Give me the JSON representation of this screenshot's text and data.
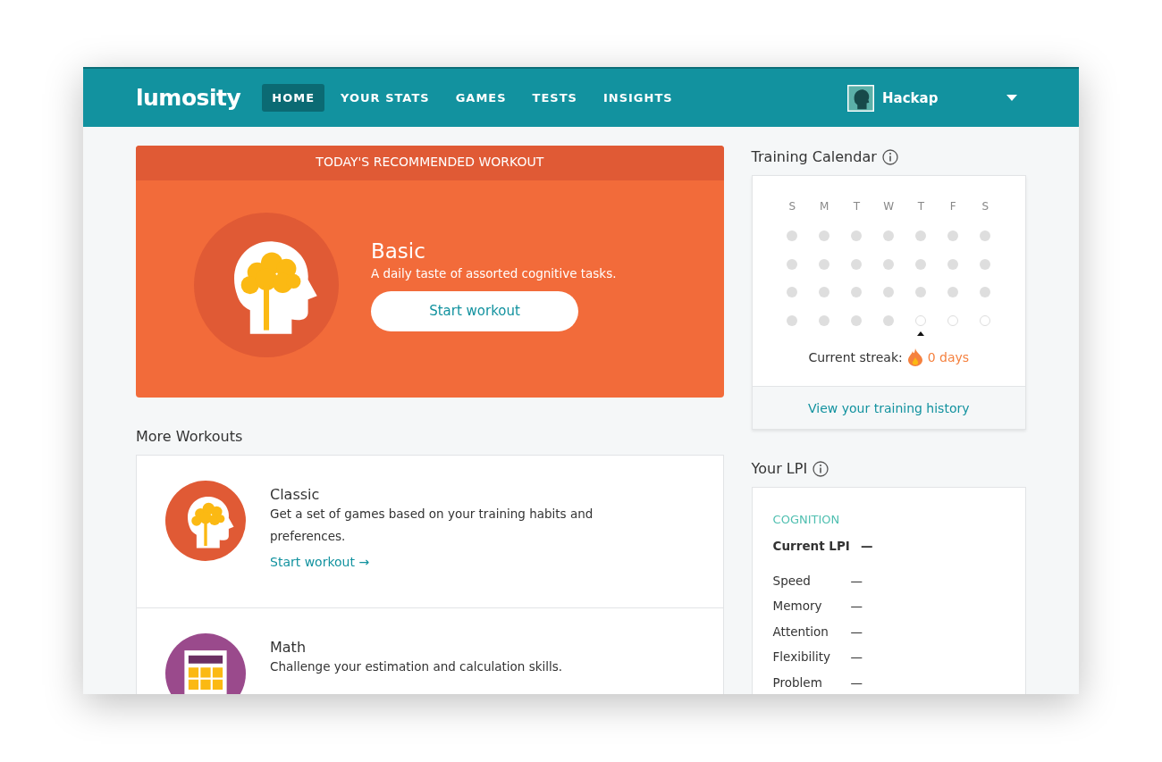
{
  "nav": {
    "logo": "lumosity",
    "items": [
      {
        "label": "HOME",
        "selected": true
      },
      {
        "label": "YOUR STATS",
        "selected": false
      },
      {
        "label": "GAMES",
        "selected": false
      },
      {
        "label": "TESTS",
        "selected": false
      },
      {
        "label": "INSIGHTS",
        "selected": false
      }
    ],
    "user": "Hackap"
  },
  "hero": {
    "banner": "TODAY'S RECOMMENDED WORKOUT",
    "title": "Basic",
    "subtitle": "A daily taste of assorted cognitive tasks.",
    "button": "Start workout"
  },
  "more_workouts": {
    "title": "More Workouts",
    "items": [
      {
        "kind": "brain",
        "color": "#e05a35",
        "title": "Classic",
        "description": "Get a set of games based on your training habits and preferences.",
        "link": "Start workout →"
      },
      {
        "kind": "calculator",
        "color": "#9a4a8c",
        "title": "Math",
        "description": "Challenge your estimation and calculation skills."
      }
    ]
  },
  "calendar": {
    "title": "Training Calendar",
    "weekdays": [
      "S",
      "M",
      "T",
      "W",
      "T",
      "F",
      "S"
    ],
    "days": [
      {
        "kind": "past"
      },
      {
        "kind": "past"
      },
      {
        "kind": "past"
      },
      {
        "kind": "past"
      },
      {
        "kind": "past"
      },
      {
        "kind": "past"
      },
      {
        "kind": "past"
      },
      {
        "kind": "past"
      },
      {
        "kind": "past"
      },
      {
        "kind": "past"
      },
      {
        "kind": "past"
      },
      {
        "kind": "past"
      },
      {
        "kind": "past"
      },
      {
        "kind": "past"
      },
      {
        "kind": "past"
      },
      {
        "kind": "past"
      },
      {
        "kind": "past"
      },
      {
        "kind": "past"
      },
      {
        "kind": "past"
      },
      {
        "kind": "past"
      },
      {
        "kind": "past"
      },
      {
        "kind": "past"
      },
      {
        "kind": "past"
      },
      {
        "kind": "past"
      },
      {
        "kind": "past"
      },
      {
        "kind": "today"
      },
      {
        "kind": "future"
      },
      {
        "kind": "future"
      }
    ],
    "streak_label": "Current streak:",
    "streak_value": "0 days",
    "history_link": "View your training history"
  },
  "lpi": {
    "title": "Your LPI",
    "section": "COGNITION",
    "current_label": "Current LPI",
    "current_value": "—",
    "rows": [
      {
        "label": "Speed",
        "value": "—"
      },
      {
        "label": "Memory",
        "value": "—"
      },
      {
        "label": "Attention",
        "value": "—"
      },
      {
        "label": "Flexibility",
        "value": "—"
      },
      {
        "label": "Problem",
        "value": "—"
      }
    ]
  }
}
